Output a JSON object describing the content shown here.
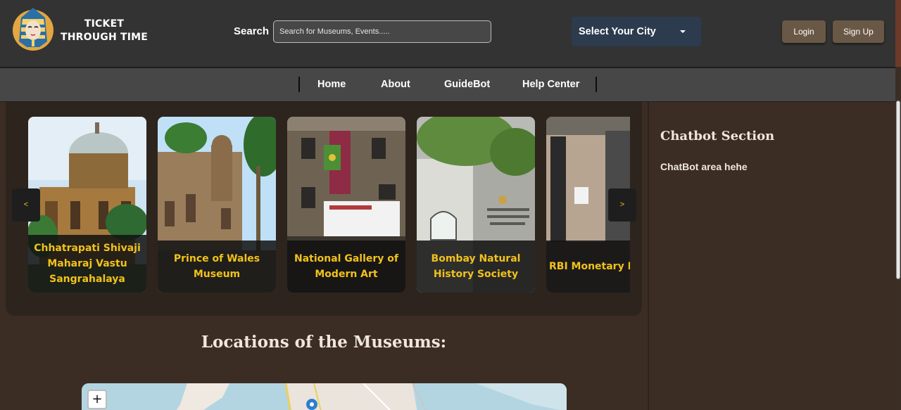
{
  "header": {
    "brand": "TICKET THROUGH TIME",
    "logo_icon": "pharaoh-mask-logo",
    "search_label": "Search",
    "search_placeholder": "Search for Museums, Events.....",
    "city_select": "Select Your City",
    "login_label": "Login",
    "signup_label": "Sign Up"
  },
  "nav": {
    "items": [
      {
        "label": "Home"
      },
      {
        "label": "About"
      },
      {
        "label": "GuideBot"
      },
      {
        "label": "Help Center"
      }
    ]
  },
  "carousel": {
    "prev_label": "<",
    "next_label": ">",
    "cards": [
      {
        "name": "Chhatrapati Shivaji Maharaj Vastu Sangrahalaya"
      },
      {
        "name": "Prince of Wales Museum"
      },
      {
        "name": "National Gallery of Modern Art"
      },
      {
        "name": "Bombay Natural History Society"
      },
      {
        "name": "RBI Monetary Museum"
      }
    ]
  },
  "locations": {
    "heading": "Locations of the Museums:",
    "zoom_in_label": "+"
  },
  "chatbot": {
    "title": "Chatbot Section",
    "body": "ChatBot area hehe"
  },
  "colors": {
    "header_bg": "#333333",
    "nav_bg": "#474747",
    "page_bg": "#3b2d24",
    "caption_text": "#f1c21b",
    "city_select_bg": "#2c3b4d",
    "auth_button_bg": "#6a5846"
  }
}
